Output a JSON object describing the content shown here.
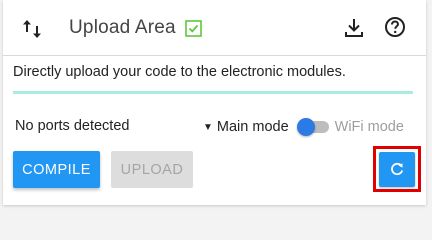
{
  "header": {
    "title": "Upload Area",
    "sort_icon": "swap-vertical-icon",
    "status_icon": "check-box-icon",
    "download_icon": "download-icon",
    "help_icon": "help-circle-icon"
  },
  "description": "Directly upload your code to the electronic modules.",
  "ports_status": "No ports detected",
  "mode": {
    "caret": "▼",
    "main_label": "Main mode",
    "wifi_label": "WiFi mode",
    "wifi_enabled": false
  },
  "buttons": {
    "compile": "COMPILE",
    "upload": "UPLOAD",
    "refresh_icon": "refresh-icon"
  },
  "colors": {
    "primary": "#2196f3",
    "accent_line": "#a9ece6",
    "check_green": "#5cc83a",
    "highlight_border": "#e00000",
    "disabled_bg": "#dddddd",
    "toggle_thumb": "#2c7be5"
  }
}
